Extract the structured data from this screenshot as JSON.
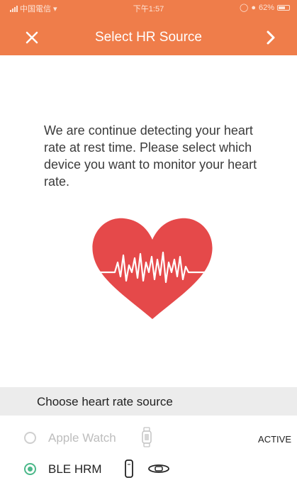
{
  "status_bar": {
    "carrier": "中国電信",
    "time": "下午1:57",
    "battery": "62%"
  },
  "navbar": {
    "close_icon": "close-icon",
    "title": "Select HR Source",
    "next_icon": "chevron-right-icon"
  },
  "main": {
    "description": "We are continue detecting your heart rate at rest time. Please select which device you want to monitor your heart rate.",
    "illustration_icon": "heart-pulse-icon"
  },
  "source_list": {
    "header": "Choose heart rate source",
    "options": [
      {
        "label": "Apple Watch",
        "icon": "apple-watch-icon",
        "badge": "ACTIVE",
        "selected": false
      },
      {
        "label": "BLE HRM",
        "icon": "fitness-band-icon",
        "icon2": "chest-strap-icon",
        "selected": true
      }
    ]
  },
  "colors": {
    "header": "#ef7d4a",
    "heart": "#e5494a",
    "radio_selected": "#4cb88a",
    "section_bg": "#ececec"
  }
}
